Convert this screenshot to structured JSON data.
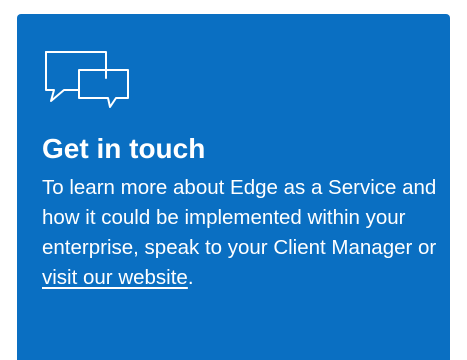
{
  "card": {
    "background_color": "#0a6fc2",
    "icon": "chat-bubbles-icon",
    "heading": "Get in touch",
    "body_text": "To learn more about Edge as a Service and how it could be implemented within your enterprise, speak to your Client Manager or ",
    "link_text": "visit our website",
    "trailing_text": "."
  }
}
